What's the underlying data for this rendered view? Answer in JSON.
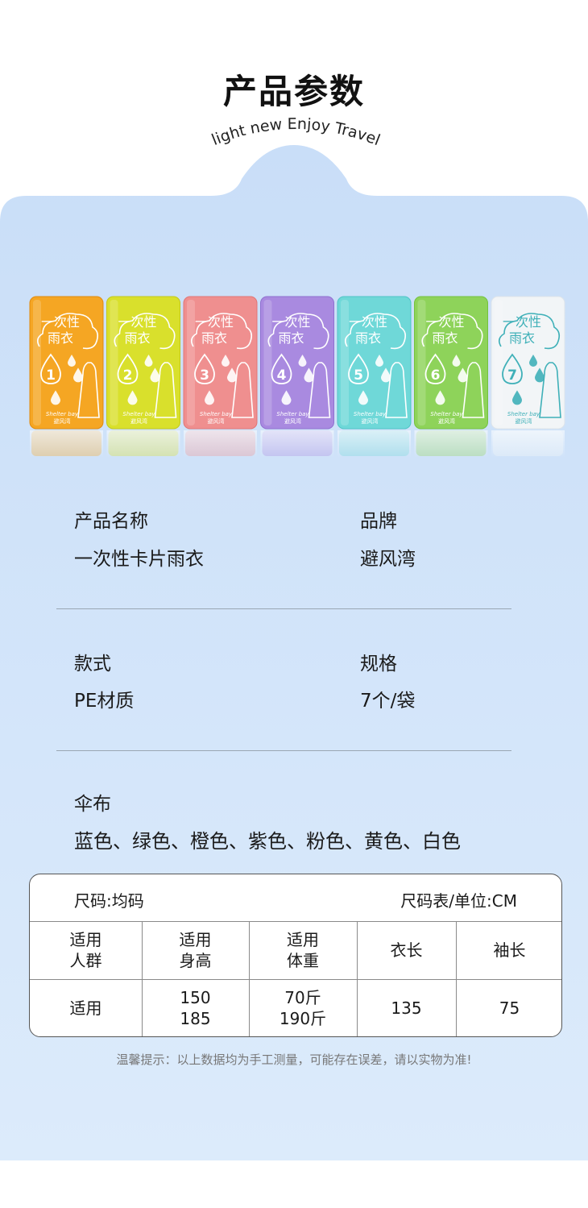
{
  "header": {
    "title": "产品参数",
    "subtitle": "light new Enjoy Travel"
  },
  "products": {
    "packs": [
      {
        "number": "1",
        "color": "#f5a623",
        "dark": "#e08a0e",
        "line1": "一次性",
        "line2": "雨衣",
        "brand_en": "Shelter bay",
        "brand_cn": "避风湾"
      },
      {
        "number": "2",
        "color": "#d9e02c",
        "dark": "#c2c817",
        "line1": "一次性",
        "line2": "雨衣",
        "brand_en": "Shelter bay",
        "brand_cn": "避风湾"
      },
      {
        "number": "3",
        "color": "#ef8f8f",
        "dark": "#e07575",
        "line1": "一次性",
        "line2": "雨衣",
        "brand_en": "Shelter bay",
        "brand_cn": "避风湾"
      },
      {
        "number": "4",
        "color": "#a98ae0",
        "dark": "#9070d0",
        "line1": "一次性",
        "line2": "雨衣",
        "brand_en": "Shelter bay",
        "brand_cn": "避风湾"
      },
      {
        "number": "5",
        "color": "#6fd8d8",
        "dark": "#4ec4c6",
        "line1": "一次性",
        "line2": "雨衣",
        "brand_en": "Shelter bay",
        "brand_cn": "避风湾"
      },
      {
        "number": "6",
        "color": "#8ed35a",
        "dark": "#74c23e",
        "line1": "一次性",
        "line2": "雨衣",
        "brand_en": "Shelter bay",
        "brand_cn": "避风湾"
      },
      {
        "number": "7",
        "color": "#f2f5f7",
        "dark": "#dfe5ea",
        "line1": "一次性",
        "line2": "雨衣",
        "brand_en": "Shelter bay",
        "brand_cn": "避风湾",
        "text_color": "#3fb0b8"
      }
    ]
  },
  "specs": {
    "name_label": "产品名称",
    "name_value": "一次性卡片雨衣",
    "brand_label": "品牌",
    "brand_value": "避风湾",
    "style_label": "款式",
    "style_value": "PE材质",
    "spec_label": "规格",
    "spec_value": "7个/袋",
    "fabric_label": "伞布",
    "fabric_value": "蓝色、绿色、橙色、紫色、粉色、黄色、白色"
  },
  "size_table": {
    "left_title": "尺码:均码",
    "right_title": "尺码表/单位:CM",
    "headers": [
      "适用\n人群",
      "适用\n身高",
      "适用\n体重",
      "衣长",
      "袖长"
    ],
    "row": [
      "适用",
      "150\n185",
      "70斤\n190斤",
      "135",
      "75"
    ]
  },
  "tip": "温馨提示：以上数据均为手工测量，可能存在误差，请以实物为准!",
  "colors": {
    "panel_top": "#cfe2f9",
    "panel_bottom": "#dcebfb"
  }
}
